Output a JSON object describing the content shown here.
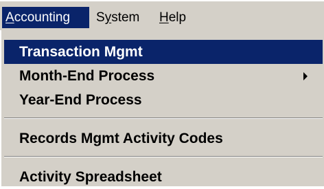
{
  "menubar": {
    "items": [
      {
        "label": "Accounting",
        "mnemonic": "A",
        "rest": "ccounting",
        "active": true
      },
      {
        "label": "System",
        "mnemonic": "y",
        "pre": "S",
        "rest": "stem",
        "active": false
      },
      {
        "label": "Help",
        "mnemonic": "H",
        "rest": "elp",
        "active": false
      }
    ]
  },
  "dropdown": {
    "items": [
      {
        "label": "Transaction Mgmt",
        "highlighted": true
      },
      {
        "label": "Month-End Process",
        "has_submenu": true
      },
      {
        "label": "Year-End Process"
      },
      {
        "label": "Records Mgmt Activity Codes"
      },
      {
        "label": "Activity Spreadsheet"
      }
    ]
  },
  "colors": {
    "menu_background": "#d4d0c8",
    "highlight": "#0a246a",
    "highlight_text": "#ffffff",
    "text": "#000000"
  }
}
